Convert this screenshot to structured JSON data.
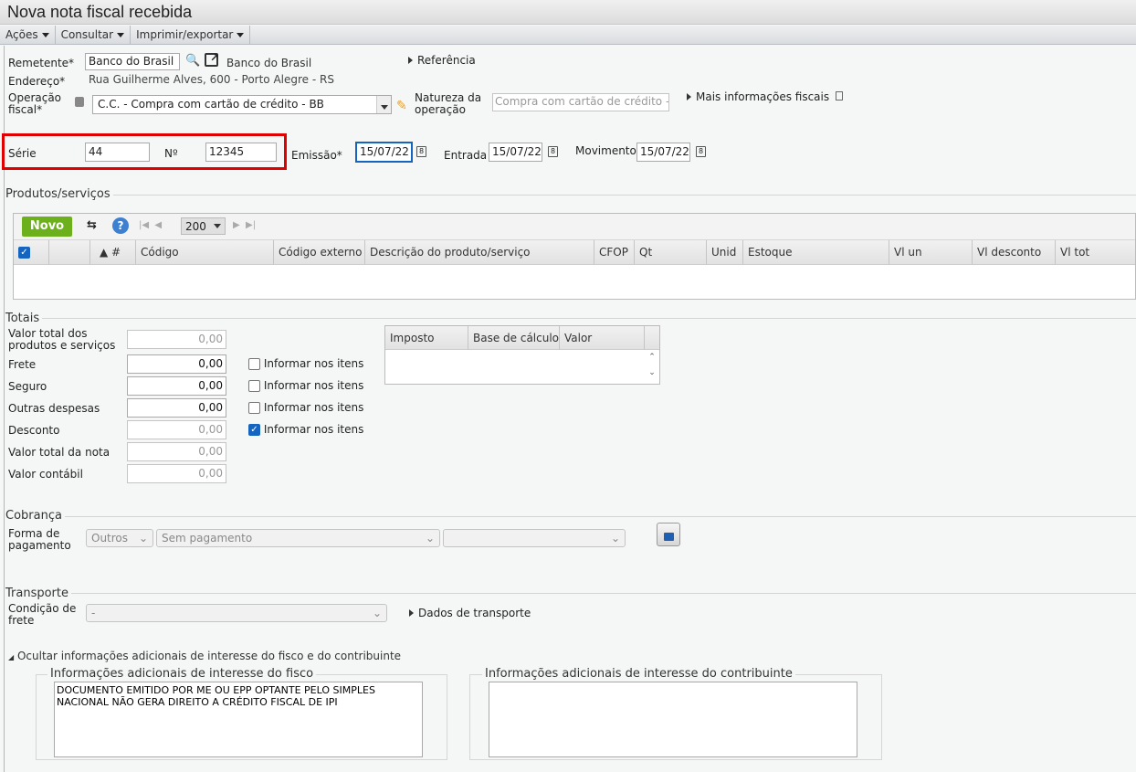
{
  "window": {
    "title": "Nova nota fiscal recebida"
  },
  "menu": [
    {
      "label": "Ações"
    },
    {
      "label": "Consultar"
    },
    {
      "label": "Imprimir/exportar"
    }
  ],
  "header": {
    "remetente_label": "Remetente*",
    "remetente_value": "Banco do Brasil",
    "remetente_name": "Banco do Brasil",
    "endereco_label": "Endereço*",
    "endereco_value": "Rua Guilherme Alves, 600 - Porto Alegre - RS",
    "operacao_label_1": "Operação",
    "operacao_label_2": "fiscal*",
    "operacao_value": "C.C. - Compra com cartão de crédito - BB",
    "natureza_label_1": "Natureza da",
    "natureza_label_2": "operação",
    "natureza_value": "Compra com cartão de crédito - I",
    "referencia": "Referência",
    "mais_info": "Mais informações fiscais",
    "serie_label": "Série",
    "serie_value": "44",
    "numero_label": "Nº",
    "numero_value": "12345",
    "emissao_label": "Emissão*",
    "emissao_value": "15/07/22",
    "entrada_label": "Entrada",
    "entrada_value": "15/07/22",
    "movimento_label": "Movimento",
    "movimento_value": "15/07/22",
    "calendar_glyph": "8"
  },
  "produtos": {
    "title": "Produtos/serviços",
    "novo": "Novo",
    "page_size": "200",
    "columns": [
      "▲ #",
      "Código",
      "Código externo",
      "Descrição do produto/serviço",
      "CFOP",
      "Qt",
      "Unid",
      "Estoque",
      "Vl un",
      "Vl desconto",
      "Vl tot"
    ]
  },
  "totais": {
    "title": "Totais",
    "rows": [
      {
        "label1": "Valor total dos",
        "label2": "produtos e serviços",
        "value": "0,00"
      },
      {
        "label1": "Frete",
        "value": "0,00",
        "check": "Informar nos itens"
      },
      {
        "label1": "Seguro",
        "value": "0,00",
        "check": "Informar nos itens"
      },
      {
        "label1": "Outras despesas",
        "value": "0,00",
        "check": "Informar nos itens"
      },
      {
        "label1": "Desconto",
        "value": "0,00",
        "check": "Informar nos itens"
      },
      {
        "label1": "Valor total da nota",
        "value": "0,00"
      },
      {
        "label1": "Valor contábil",
        "value": "0,00"
      }
    ],
    "imposto_columns": [
      "Imposto",
      "Base de cálculo",
      "Valor"
    ]
  },
  "cobranca": {
    "title": "Cobrança",
    "label1": "Forma de",
    "label2": "pagamento",
    "forma": "Outros",
    "condicao": "Sem pagamento"
  },
  "transporte": {
    "title": "Transporte",
    "label1": "Condição de",
    "label2": "frete",
    "value": "-",
    "dados": "Dados de transporte"
  },
  "adicionais": {
    "toggle": "Ocultar informações adicionais de interesse do fisco e do contribuinte",
    "fisco_title": "Informações adicionais de interesse do fisco",
    "fisco_value": "DOCUMENTO EMITIDO POR ME OU EPP OPTANTE PELO SIMPLES NACIONAL NÃO GERA DIREITO A CRÉDITO FISCAL DE IPI",
    "contribuinte_title": "Informações adicionais de interesse do contribuinte",
    "contribuinte_value": ""
  }
}
